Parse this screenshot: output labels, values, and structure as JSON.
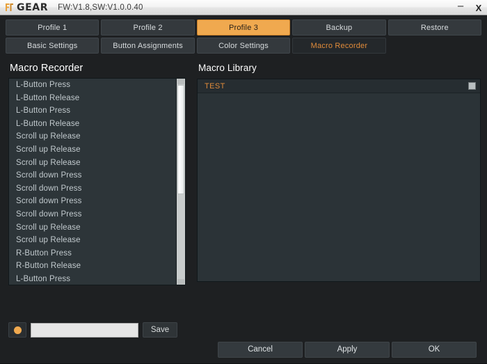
{
  "titlebar": {
    "brand": "GEAR",
    "logo_icon": "fnatic-gear-logo-icon",
    "version": "FW:V1.8,SW:V1.0.0.40",
    "minimize_label": "–",
    "close_label": "X",
    "accent_color": "#e08b3a"
  },
  "tabs": {
    "primary": [
      {
        "label": "Profile 1",
        "active": false
      },
      {
        "label": "Profile 2",
        "active": false
      },
      {
        "label": "Profile 3",
        "active": true
      },
      {
        "label": "Backup",
        "active": false
      },
      {
        "label": "Restore",
        "active": false
      }
    ],
    "secondary": [
      {
        "label": "Basic Settings",
        "active": false
      },
      {
        "label": "Button Assignments",
        "active": false
      },
      {
        "label": "Color Settings",
        "active": false
      },
      {
        "label": "Macro Recorder",
        "active": true
      }
    ]
  },
  "recorder": {
    "title": "Macro Recorder",
    "events": [
      "L-Button Press",
      "L-Button Release",
      "L-Button Press",
      "L-Button Release",
      "Scroll up Release",
      "Scroll up Release",
      "Scroll up Release",
      "Scroll down Press",
      "Scroll down Press",
      "Scroll down Press",
      "Scroll down Press",
      "Scroll up Release",
      "Scroll up Release",
      "R-Button Press",
      "R-Button Release",
      "L-Button Press"
    ],
    "scrollbar": {
      "thumb_top_pct": 3,
      "thumb_height_pct": 53
    }
  },
  "library": {
    "title": "Macro Library",
    "rows": [
      {
        "name": "TEST",
        "delete_icon": "delete-icon"
      }
    ]
  },
  "saverow": {
    "record_icon": "record-dot-icon",
    "name_value": "",
    "name_placeholder": "",
    "save_label": "Save"
  },
  "footer": {
    "cancel_label": "Cancel",
    "apply_label": "Apply",
    "ok_label": "OK"
  },
  "colors": {
    "accent_orange": "#f0a94f",
    "text_orange": "#e08b3a",
    "panel_bg": "#2d3539",
    "window_bg": "#1e2022"
  }
}
